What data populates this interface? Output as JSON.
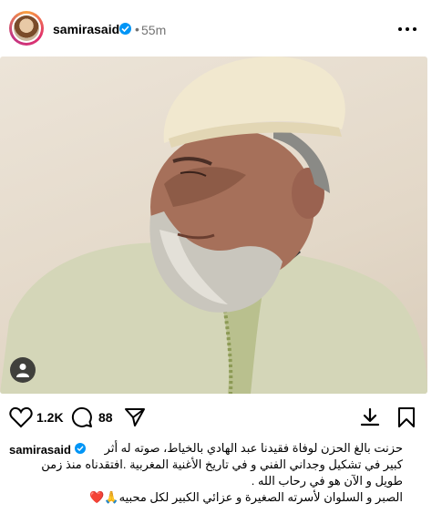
{
  "post": {
    "username": "samirasaid",
    "separator": "•",
    "time": "55m"
  },
  "actions": {
    "likes": "1.2K",
    "comments": "88"
  },
  "caption": {
    "username": "samirasaid",
    "lines": [
      "حزنت بالغ الحزن لوفاة فقيدنا عبد الهادي بالخياط، صوته له أثر",
      "كبير في تشكيل وجداني الفني و في تاريخ الأغنية المغربية .افتقدناه منذ زمن",
      "طويل و الآن هو في رحاب الله .",
      "الصبر و السلوان لأسرته الصغيرة و عزائي الكبير لكل محبيه🙏❤️"
    ]
  },
  "icons": [
    "verified-badge-icon",
    "more-icon",
    "user-tag-icon",
    "heart-icon",
    "comment-icon",
    "share-icon",
    "download-icon",
    "bookmark-icon"
  ],
  "colors": {
    "verified": "#0095f6",
    "muted": "#737373"
  }
}
